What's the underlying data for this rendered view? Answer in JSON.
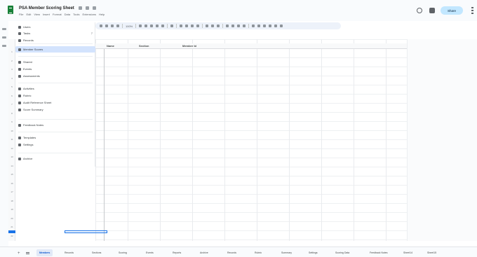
{
  "app": {
    "doc_title": "PSA Member Scoring Sheet",
    "share_label": "Share",
    "menus": [
      "File",
      "Edit",
      "View",
      "Insert",
      "Format",
      "Data",
      "Tools",
      "Extensions",
      "Help"
    ]
  },
  "toolbar": {
    "zoom": "100%"
  },
  "panel": {
    "items": [
      {
        "icon": "table-icon",
        "label": "Users",
        "count": "",
        "selected": false
      },
      {
        "icon": "table-icon",
        "label": "Tasks",
        "count": "7",
        "selected": false
      },
      {
        "icon": "table-icon",
        "label": "Records",
        "count": "",
        "selected": false
      },
      {
        "icon": "table-icon",
        "label": "Member Scores",
        "count": "",
        "selected": true
      },
      {
        "icon": "table-icon",
        "label": "Shared",
        "count": "",
        "selected": false
      },
      {
        "icon": "table-icon",
        "label": "Events",
        "count": "",
        "selected": false
      },
      {
        "icon": "table-icon",
        "label": "Assessments",
        "count": "",
        "selected": false
      },
      {
        "icon": "table-icon",
        "label": "Activities",
        "count": "",
        "selected": false
      },
      {
        "icon": "table-icon",
        "label": "Rubric",
        "count": "",
        "selected": false
      },
      {
        "icon": "table-icon",
        "label": "Audit Reference Sheet",
        "count": "",
        "selected": false
      },
      {
        "icon": "table-icon",
        "label": "Score Summary",
        "count": "",
        "selected": false
      },
      {
        "icon": "table-icon",
        "label": "Feedback Notes",
        "count": "",
        "selected": false
      },
      {
        "icon": "table-icon",
        "label": "Templates",
        "count": "",
        "selected": false
      },
      {
        "icon": "table-icon",
        "label": "Settings",
        "count": "",
        "selected": false
      },
      {
        "icon": "table-icon",
        "label": "Archive",
        "count": "",
        "selected": false
      }
    ]
  },
  "grid": {
    "columns": [
      "Name",
      "Section",
      "Member Id"
    ],
    "row_numbers": [
      "1",
      "2",
      "3",
      "4",
      "5",
      "6",
      "7",
      "8",
      "9",
      "10",
      "11",
      "12",
      "13",
      "14",
      "15",
      "16",
      "17",
      "18",
      "19",
      "20",
      "21",
      "22"
    ]
  },
  "tabs": {
    "add_label": "+",
    "items": [
      {
        "label": "Members",
        "active": true
      },
      {
        "label": "Records",
        "active": false
      },
      {
        "label": "Sections",
        "active": false
      },
      {
        "label": "Scoring",
        "active": false
      },
      {
        "label": "Events",
        "active": false
      },
      {
        "label": "Reports",
        "active": false
      },
      {
        "label": "Archive",
        "active": false
      },
      {
        "label": "Records",
        "active": false
      },
      {
        "label": "Rubric",
        "active": false
      },
      {
        "label": "Summary",
        "active": false
      },
      {
        "label": "Settings",
        "active": false
      },
      {
        "label": "Scoring Data",
        "active": false
      },
      {
        "label": "Feedback Notes",
        "active": false
      },
      {
        "label": "Sheet14",
        "active": false
      },
      {
        "label": "Sheet15",
        "active": false
      }
    ]
  }
}
